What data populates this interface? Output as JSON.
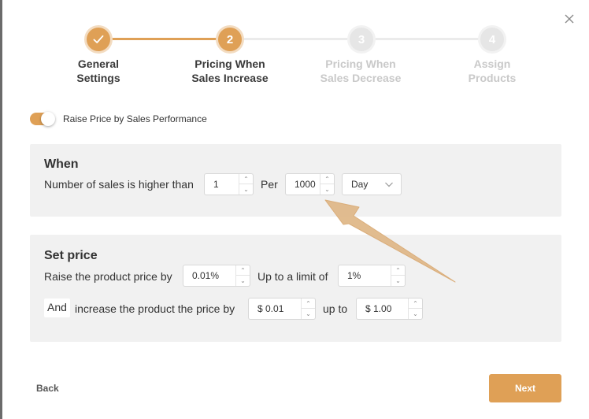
{
  "colors": {
    "accent": "#dfa056",
    "accent_light": "#f3dcc1",
    "inactive": "#e6e6e6",
    "panel_bg": "#f1f1f1"
  },
  "stepper": {
    "steps": [
      {
        "number": "",
        "icon": "check-icon",
        "label_line1": "General",
        "label_line2": "Settings",
        "state": "done"
      },
      {
        "number": "2",
        "label_line1": "Pricing When",
        "label_line2": "Sales Increase",
        "state": "active"
      },
      {
        "number": "3",
        "label_line1": "Pricing When",
        "label_line2": "Sales Decrease",
        "state": "todo"
      },
      {
        "number": "4",
        "label_line1": "Assign",
        "label_line2": "Products",
        "state": "todo"
      }
    ]
  },
  "toggle": {
    "label": "Raise Price by Sales Performance",
    "on": true
  },
  "when": {
    "title": "When",
    "sales_label": "Number of sales is higher than",
    "sales_value": "1",
    "per_label": "Per",
    "per_value": "1000",
    "period_value": "Day"
  },
  "set_price": {
    "title": "Set price",
    "raise_label": "Raise the product price by",
    "raise_value": "0.01%",
    "limit_label": "Up to a limit of",
    "limit_value": "1%",
    "and_label": "And",
    "increase_label": "increase the product the price by",
    "increase_value": "$ 0.01",
    "upto_label": "up to",
    "upto_value": "$ 1.00"
  },
  "footer": {
    "back_label": "Back",
    "next_label": "Next"
  }
}
